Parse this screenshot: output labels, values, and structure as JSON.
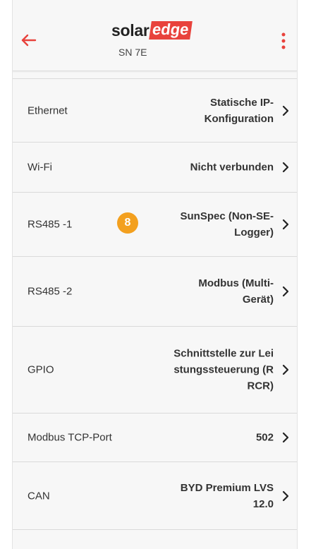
{
  "header": {
    "logo_solar": "solar",
    "logo_edge": "edge",
    "serial": "SN 7E"
  },
  "colors": {
    "accent_red": "#e8423c",
    "badge_orange": "#f3a01f",
    "background": "#f7f7f7"
  },
  "icons": {
    "back": "arrow-left-icon",
    "menu": "more-vertical-icon",
    "row": "chevron-right-icon"
  },
  "rows": [
    {
      "label": "Ethernet",
      "value": "Statische IP-Konfiguration"
    },
    {
      "label": "Wi-Fi",
      "value": "Nicht verbunden"
    },
    {
      "label": "RS485 -1",
      "value": "SunSpec (Non-SE-Logger)",
      "badge": "8"
    },
    {
      "label": "RS485 -2",
      "value": "Modbus (Multi-Gerät)"
    },
    {
      "label": "GPIO",
      "value": "Schnittstelle zur Leistungssteuerung (RRCR)"
    },
    {
      "label": "Modbus TCP-Port",
      "value": "502"
    },
    {
      "label": "CAN",
      "value": "BYD Premium LVS 12.0"
    }
  ]
}
